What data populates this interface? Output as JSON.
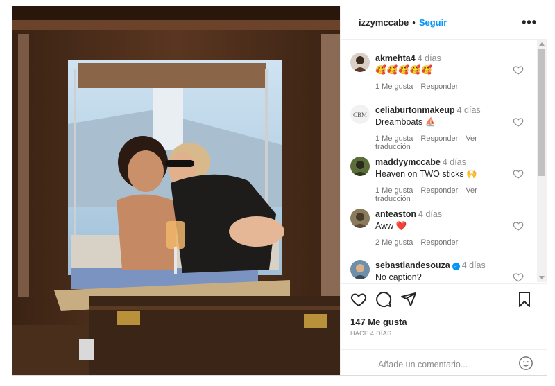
{
  "post": {
    "username": "izzymccabe",
    "separator": "•",
    "follow_label": "Seguir",
    "more_label": "•••"
  },
  "comments": [
    {
      "user": "akmehta4",
      "time": "4 días",
      "text": "🥰🥰🥰🥰🥰",
      "likes": "1 Me gusta",
      "reply": "Responder",
      "translate": "",
      "verified": false
    },
    {
      "user": "celiaburtonmakeup",
      "time": "4 días",
      "text": "Dreamboats ⛵",
      "likes": "1 Me gusta",
      "reply": "Responder",
      "translate": "Ver traducción",
      "verified": false
    },
    {
      "user": "maddyymccabe",
      "time": "4 días",
      "text": "Heaven on TWO sticks 🙌",
      "likes": "1 Me gusta",
      "reply": "Responder",
      "translate": "Ver traducción",
      "verified": false
    },
    {
      "user": "anteaston",
      "time": "4 días",
      "text": "Aww ❤️",
      "likes": "2 Me gusta",
      "reply": "Responder",
      "translate": "",
      "verified": false
    },
    {
      "user": "sebastiandesouza",
      "time": "4 días",
      "text": "No caption?",
      "likes": "",
      "reply": "",
      "translate": "",
      "verified": true
    }
  ],
  "footer": {
    "likes_count": "147 Me gusta",
    "time_ago": "HACE 4 DÍAS",
    "add_comment_placeholder": "Añade un comentario..."
  },
  "icons": {
    "like": "heart-icon",
    "comment": "comment-icon",
    "share": "paper-plane-icon",
    "save": "bookmark-icon",
    "emoji": "smiley-icon"
  },
  "colors": {
    "accent": "#0095f6",
    "heart_red": "#ed4956",
    "muted": "#8e8e8e"
  }
}
